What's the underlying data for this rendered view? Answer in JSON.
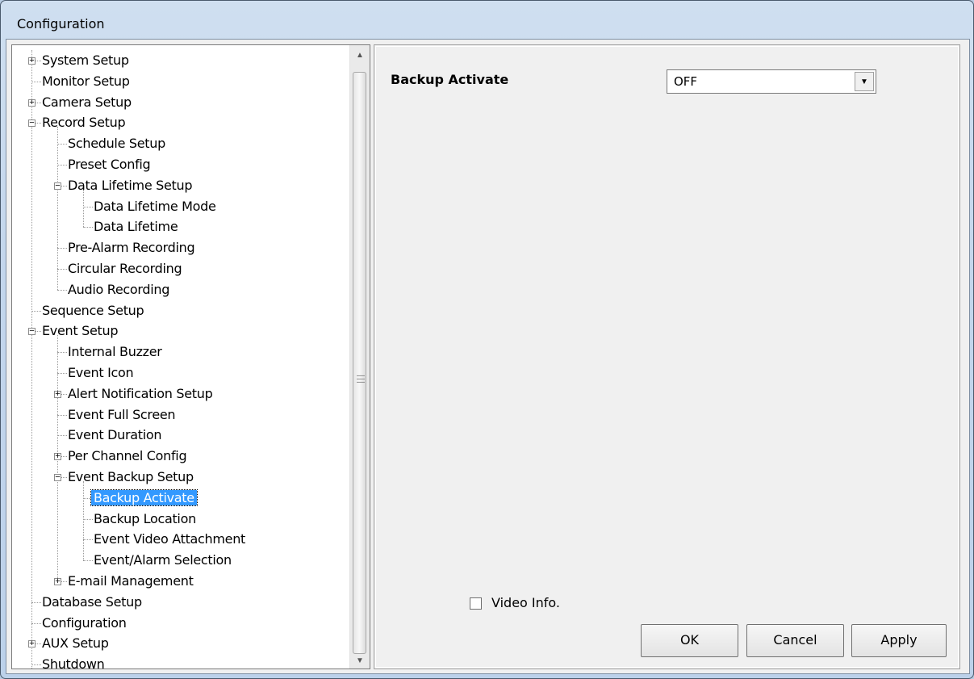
{
  "window": {
    "title": "Configuration"
  },
  "tree": {
    "items": [
      {
        "label": "System Setup",
        "level": 0,
        "expander": "plus"
      },
      {
        "label": "Monitor Setup",
        "level": 0,
        "expander": "none"
      },
      {
        "label": "Camera Setup",
        "level": 0,
        "expander": "plus"
      },
      {
        "label": "Record Setup",
        "level": 0,
        "expander": "minus"
      },
      {
        "label": "Schedule Setup",
        "level": 1,
        "expander": "none"
      },
      {
        "label": "Preset Config",
        "level": 1,
        "expander": "none"
      },
      {
        "label": "Data Lifetime Setup",
        "level": 1,
        "expander": "minus"
      },
      {
        "label": "Data Lifetime Mode",
        "level": 2,
        "expander": "none"
      },
      {
        "label": "Data Lifetime",
        "level": 2,
        "expander": "none"
      },
      {
        "label": "Pre-Alarm Recording",
        "level": 1,
        "expander": "none"
      },
      {
        "label": "Circular Recording",
        "level": 1,
        "expander": "none"
      },
      {
        "label": "Audio Recording",
        "level": 1,
        "expander": "none"
      },
      {
        "label": "Sequence Setup",
        "level": 0,
        "expander": "none"
      },
      {
        "label": "Event Setup",
        "level": 0,
        "expander": "minus"
      },
      {
        "label": "Internal Buzzer",
        "level": 1,
        "expander": "none"
      },
      {
        "label": "Event Icon",
        "level": 1,
        "expander": "none"
      },
      {
        "label": "Alert Notification Setup",
        "level": 1,
        "expander": "plus"
      },
      {
        "label": "Event Full Screen",
        "level": 1,
        "expander": "none"
      },
      {
        "label": "Event Duration",
        "level": 1,
        "expander": "none"
      },
      {
        "label": "Per Channel Config",
        "level": 1,
        "expander": "plus"
      },
      {
        "label": "Event Backup Setup",
        "level": 1,
        "expander": "minus"
      },
      {
        "label": "Backup Activate",
        "level": 2,
        "expander": "none",
        "selected": true
      },
      {
        "label": "Backup Location",
        "level": 2,
        "expander": "none"
      },
      {
        "label": "Event Video Attachment",
        "level": 2,
        "expander": "none"
      },
      {
        "label": "Event/Alarm Selection",
        "level": 2,
        "expander": "none"
      },
      {
        "label": "E-mail Management",
        "level": 1,
        "expander": "plus"
      },
      {
        "label": "Database Setup",
        "level": 0,
        "expander": "none"
      },
      {
        "label": "Configuration",
        "level": 0,
        "expander": "none"
      },
      {
        "label": "AUX Setup",
        "level": 0,
        "expander": "plus"
      },
      {
        "label": "Shutdown",
        "level": 0,
        "expander": "none"
      }
    ]
  },
  "panel": {
    "setting_label": "Backup Activate",
    "setting_value": "OFF",
    "video_info_label": "Video Info.",
    "video_info_checked": false
  },
  "buttons": {
    "ok": "OK",
    "cancel": "Cancel",
    "apply": "Apply"
  },
  "colors": {
    "selection": "#3399ff",
    "dialog_bg": "#f0f0f0"
  }
}
